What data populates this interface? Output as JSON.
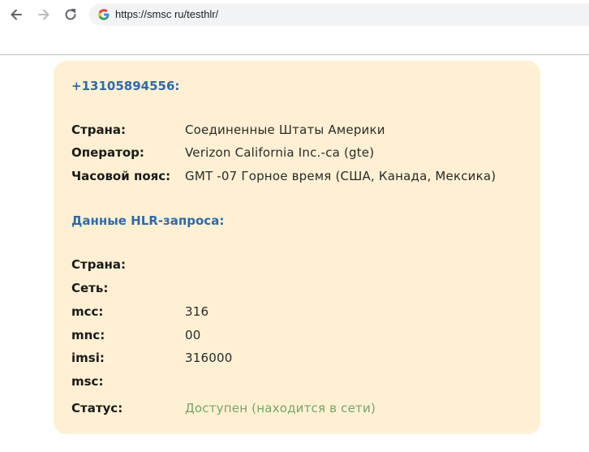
{
  "browser": {
    "url": "https://smsc ru/testhlr/"
  },
  "card": {
    "phone": "+13105894556:",
    "info": [
      {
        "label": "Страна:",
        "value": "Соединенные Штаты Америки"
      },
      {
        "label": "Оператор:",
        "value": "Verizon California Inc.-ca (gte)"
      },
      {
        "label": "Часовой пояс:",
        "value": "GMT -07 Горное время (США, Канада, Мексика)"
      }
    ],
    "hlr_heading": "Данные HLR-запроса:",
    "hlr": [
      {
        "label": "Страна:",
        "value": ""
      },
      {
        "label": "Сеть:",
        "value": ""
      },
      {
        "label": "mcc:",
        "value": "316"
      },
      {
        "label": "mnc:",
        "value": "00"
      },
      {
        "label": "imsi:",
        "value": "316000"
      },
      {
        "label": "msc:",
        "value": ""
      }
    ],
    "status": {
      "label": "Статус:",
      "value": "Доступен (находится в сети)"
    }
  },
  "colors": {
    "card_bg": "#fff0d4",
    "heading": "#2f6aa8",
    "status_ok": "#73a56a"
  }
}
